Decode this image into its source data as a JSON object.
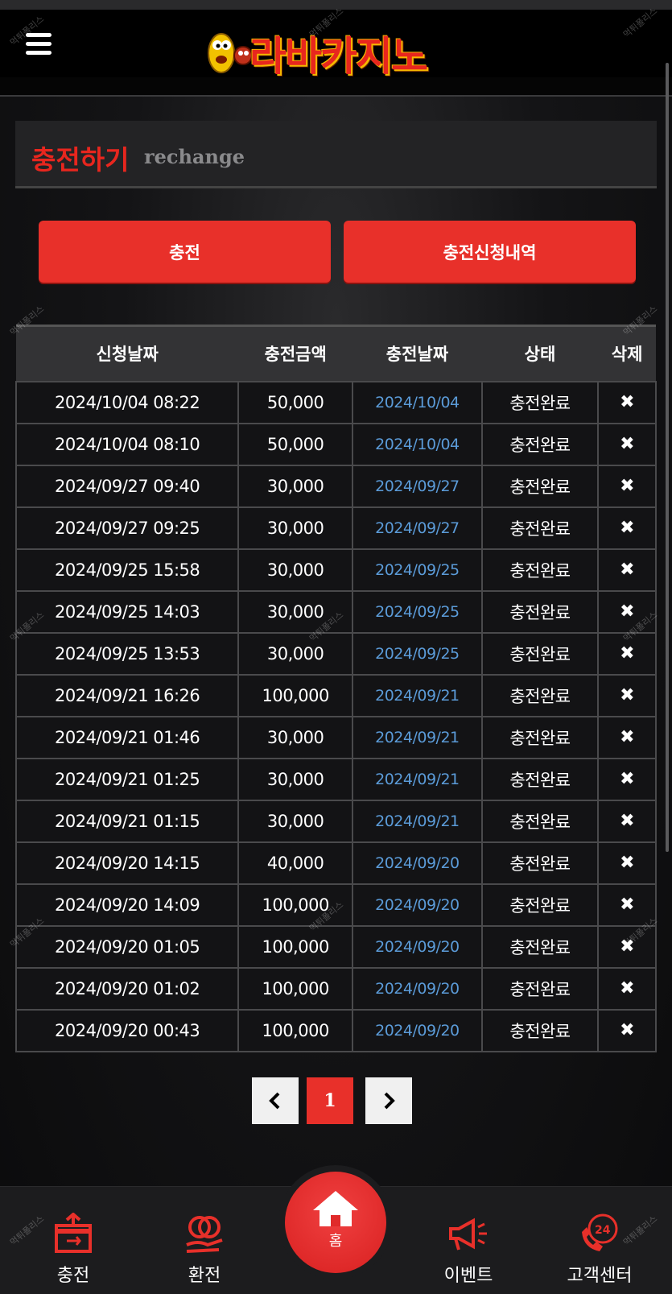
{
  "brand": {
    "name": "라바카지노"
  },
  "page": {
    "title_ko": "충전하기",
    "title_en": "rechange"
  },
  "actions": {
    "charge_label": "충전",
    "history_label": "충전신청내역"
  },
  "table": {
    "headers": [
      "신청날짜",
      "충전금액",
      "충전날짜",
      "상태",
      "삭제"
    ],
    "rows": [
      {
        "req": "2024/10/04 08:22",
        "amount": "50,000",
        "date": "2024/10/04",
        "status": "충전완료"
      },
      {
        "req": "2024/10/04 08:10",
        "amount": "50,000",
        "date": "2024/10/04",
        "status": "충전완료"
      },
      {
        "req": "2024/09/27 09:40",
        "amount": "30,000",
        "date": "2024/09/27",
        "status": "충전완료"
      },
      {
        "req": "2024/09/27 09:25",
        "amount": "30,000",
        "date": "2024/09/27",
        "status": "충전완료"
      },
      {
        "req": "2024/09/25 15:58",
        "amount": "30,000",
        "date": "2024/09/25",
        "status": "충전완료"
      },
      {
        "req": "2024/09/25 14:03",
        "amount": "30,000",
        "date": "2024/09/25",
        "status": "충전완료"
      },
      {
        "req": "2024/09/25 13:53",
        "amount": "30,000",
        "date": "2024/09/25",
        "status": "충전완료"
      },
      {
        "req": "2024/09/21 16:26",
        "amount": "100,000",
        "date": "2024/09/21",
        "status": "충전완료"
      },
      {
        "req": "2024/09/21 01:46",
        "amount": "30,000",
        "date": "2024/09/21",
        "status": "충전완료"
      },
      {
        "req": "2024/09/21 01:25",
        "amount": "30,000",
        "date": "2024/09/21",
        "status": "충전완료"
      },
      {
        "req": "2024/09/21 01:15",
        "amount": "30,000",
        "date": "2024/09/21",
        "status": "충전완료"
      },
      {
        "req": "2024/09/20 14:15",
        "amount": "40,000",
        "date": "2024/09/20",
        "status": "충전완료"
      },
      {
        "req": "2024/09/20 14:09",
        "amount": "100,000",
        "date": "2024/09/20",
        "status": "충전완료"
      },
      {
        "req": "2024/09/20 01:05",
        "amount": "100,000",
        "date": "2024/09/20",
        "status": "충전완료"
      },
      {
        "req": "2024/09/20 01:02",
        "amount": "100,000",
        "date": "2024/09/20",
        "status": "충전완료"
      },
      {
        "req": "2024/09/20 00:43",
        "amount": "100,000",
        "date": "2024/09/20",
        "status": "충전완료"
      }
    ],
    "delete_glyph": "✖"
  },
  "pagination": {
    "prev": "‹",
    "current": "1",
    "next": "›"
  },
  "bottom_nav": {
    "charge": "충전",
    "exchange": "환전",
    "home": "홈",
    "event": "이벤트",
    "support": "고객센터"
  },
  "watermark": "먹튀폴리스",
  "colors": {
    "accent": "#e8302a",
    "link": "#5b9bd8"
  }
}
